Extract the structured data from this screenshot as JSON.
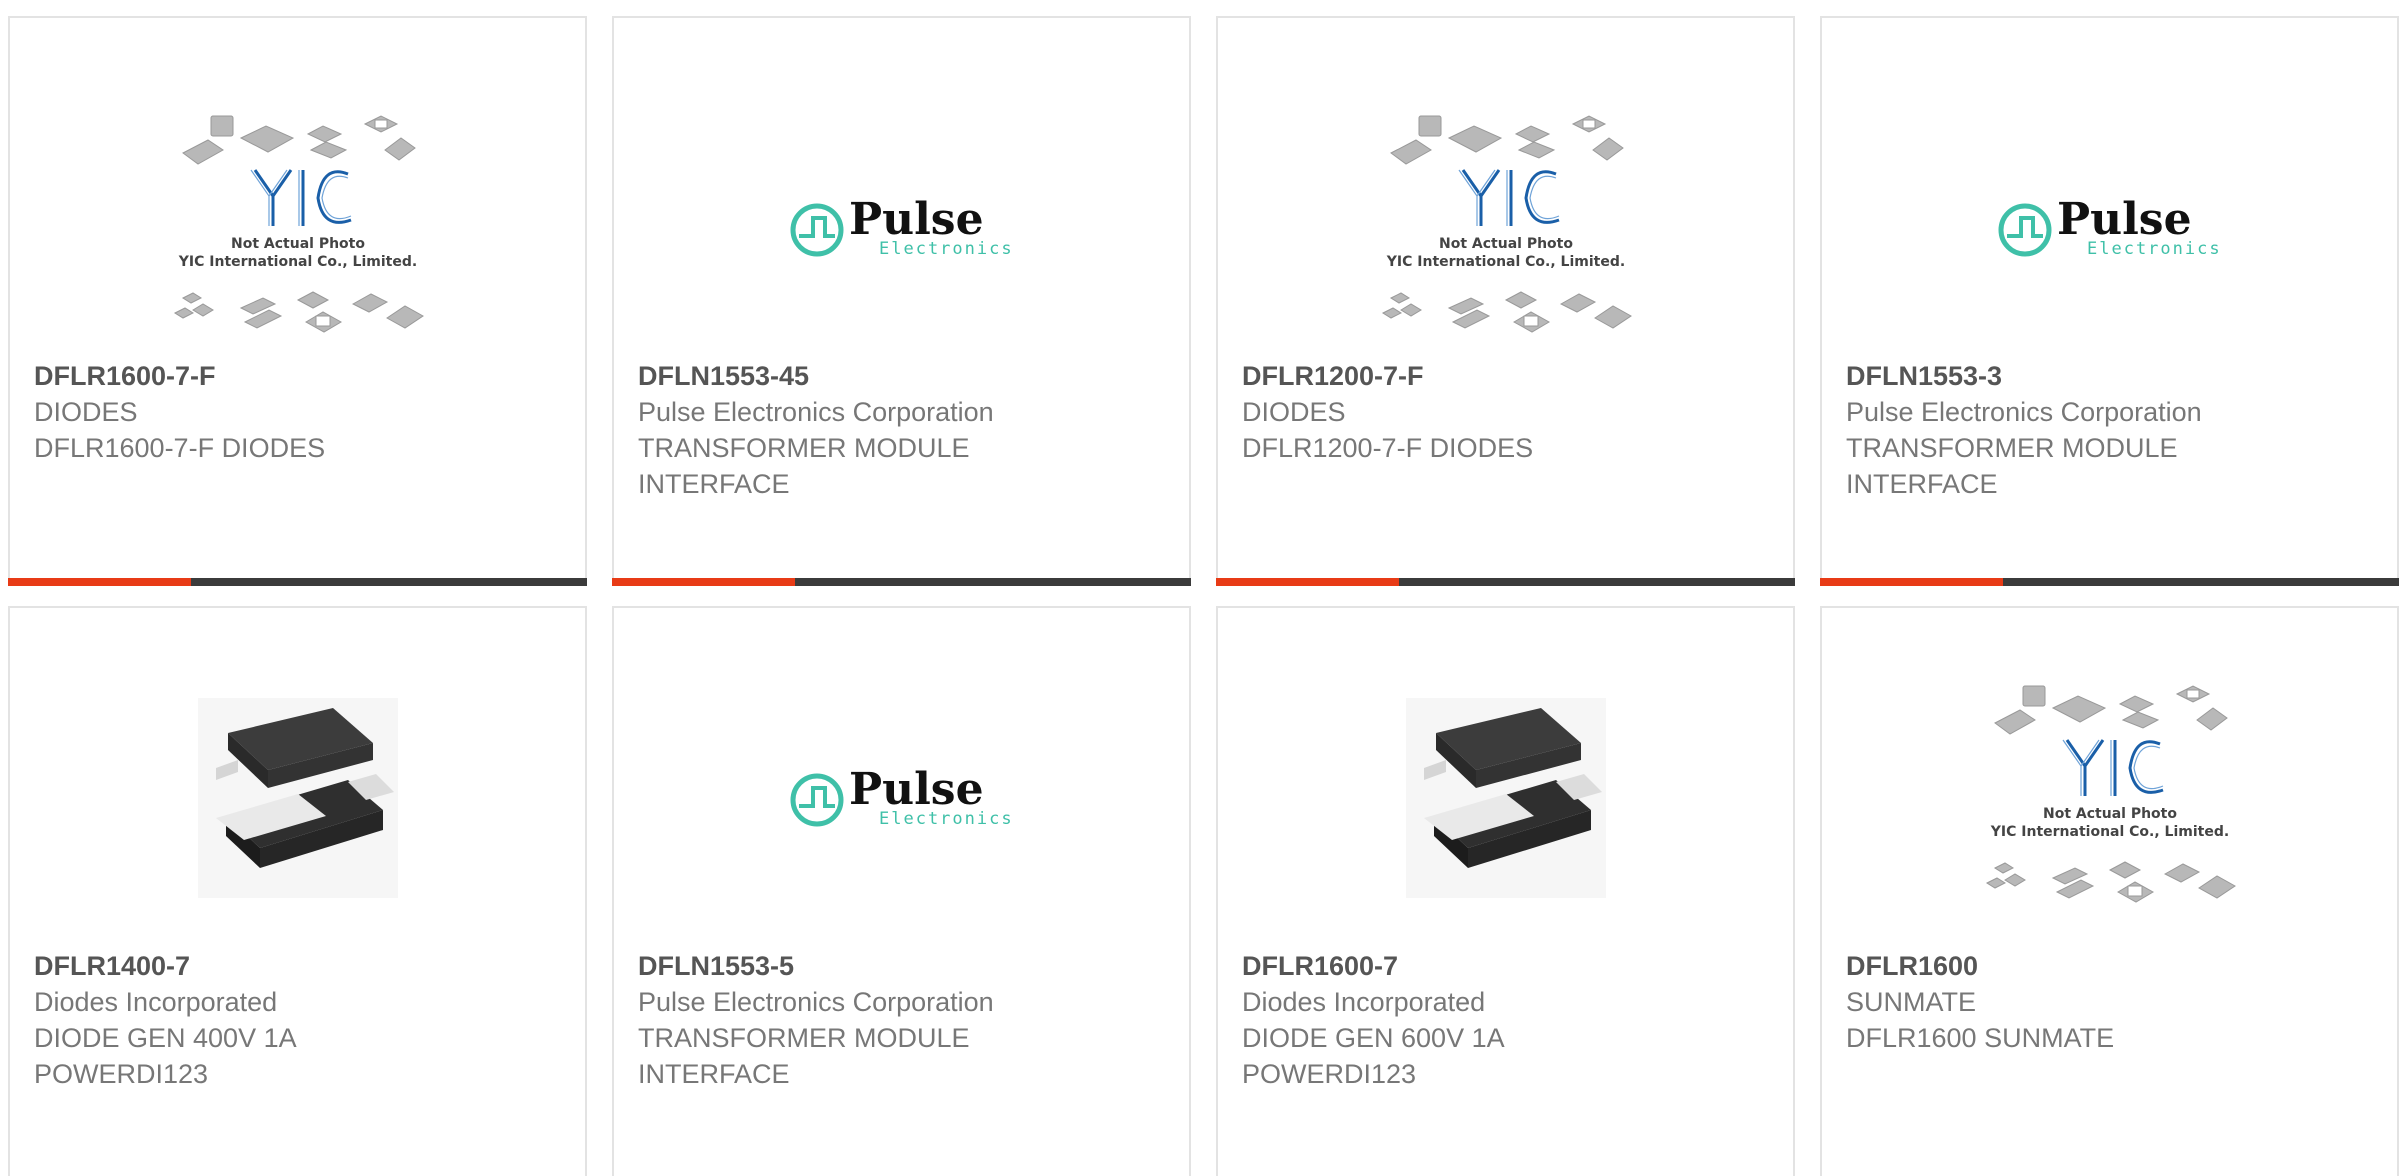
{
  "colors": {
    "accent": "#e83b16",
    "bar": "#3b3b3b",
    "card_border": "#e3e3e3",
    "pulse_teal": "#3fc0a8",
    "yic_blue": "#1a5fa8"
  },
  "products": [
    {
      "part": "DFLR1600-7-F",
      "brand": "DIODES",
      "desc": "DFLR1600-7-F DIODES",
      "image": "yic",
      "image_text": [
        "Not Actual Photo",
        "YIC International Co., Limited."
      ]
    },
    {
      "part": "DFLN1553-45",
      "brand": "Pulse Electronics Corporation",
      "desc": "TRANSFORMER MODULE INTERFACE",
      "image": "pulse",
      "image_text": [
        "Pulse",
        "Electronics"
      ]
    },
    {
      "part": "DFLR1200-7-F",
      "brand": "DIODES",
      "desc": "DFLR1200-7-F DIODES",
      "image": "yic",
      "image_text": [
        "Not Actual Photo",
        "YIC International Co., Limited."
      ]
    },
    {
      "part": "DFLN1553-3",
      "brand": "Pulse Electronics Corporation",
      "desc": "TRANSFORMER MODULE INTERFACE",
      "image": "pulse",
      "image_text": [
        "Pulse",
        "Electronics"
      ]
    },
    {
      "part": "DFLR1400-7",
      "brand": "Diodes Incorporated",
      "desc": "DIODE GEN 400V 1A POWERDI123",
      "image": "diode",
      "image_text": []
    },
    {
      "part": "DFLN1553-5",
      "brand": "Pulse Electronics Corporation",
      "desc": "TRANSFORMER MODULE INTERFACE",
      "image": "pulse",
      "image_text": [
        "Pulse",
        "Electronics"
      ]
    },
    {
      "part": "DFLR1600-7",
      "brand": "Diodes Incorporated",
      "desc": "DIODE GEN 600V 1A POWERDI123",
      "image": "diode",
      "image_text": []
    },
    {
      "part": "DFLR1600",
      "brand": "SUNMATE",
      "desc": "DFLR1600 SUNMATE",
      "image": "yic",
      "image_text": [
        "Not Actual Photo",
        "YIC International Co., Limited."
      ]
    }
  ]
}
